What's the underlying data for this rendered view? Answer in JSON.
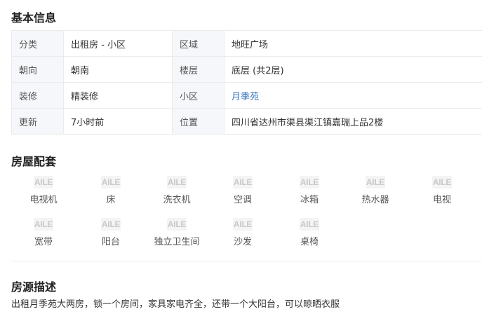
{
  "basic_info": {
    "title": "基本信息",
    "rows": [
      [
        {
          "label": "分类",
          "value": "出租房 - 小区"
        },
        {
          "label": "区域",
          "value": "地旺广场"
        }
      ],
      [
        {
          "label": "朝向",
          "value": "朝南"
        },
        {
          "label": "楼层",
          "value": "底层 (共2层)"
        }
      ],
      [
        {
          "label": "装修",
          "value": "精装修"
        },
        {
          "label": "小区",
          "value": "月季苑",
          "link": true
        }
      ],
      [
        {
          "label": "更新",
          "value": "7小时前"
        },
        {
          "label": "位置",
          "value": "四川省达州市渠县渠江镇嘉瑞上品2楼"
        }
      ]
    ],
    "link_color": "#2f6fbf"
  },
  "facilities": {
    "title": "房屋配套",
    "icon_text": "AILE",
    "items": [
      {
        "label": "电视机",
        "icon": "tv-icon"
      },
      {
        "label": "床",
        "icon": "bed-icon"
      },
      {
        "label": "洗衣机",
        "icon": "washing-machine-icon"
      },
      {
        "label": "空调",
        "icon": "air-conditioner-icon"
      },
      {
        "label": "冰箱",
        "icon": "fridge-icon"
      },
      {
        "label": "热水器",
        "icon": "water-heater-icon"
      },
      {
        "label": "电视",
        "icon": "tv-icon"
      },
      {
        "label": "宽带",
        "icon": "broadband-icon"
      },
      {
        "label": "阳台",
        "icon": "balcony-icon"
      },
      {
        "label": "独立卫生间",
        "icon": "bathroom-icon"
      },
      {
        "label": "沙发",
        "icon": "sofa-icon"
      },
      {
        "label": "桌椅",
        "icon": "table-chair-icon"
      }
    ]
  },
  "description": {
    "title": "房源描述",
    "text": "出租月季苑大两房，锁一个房间，家具家电齐全，还带一个大阳台，可以晾晒衣服"
  }
}
